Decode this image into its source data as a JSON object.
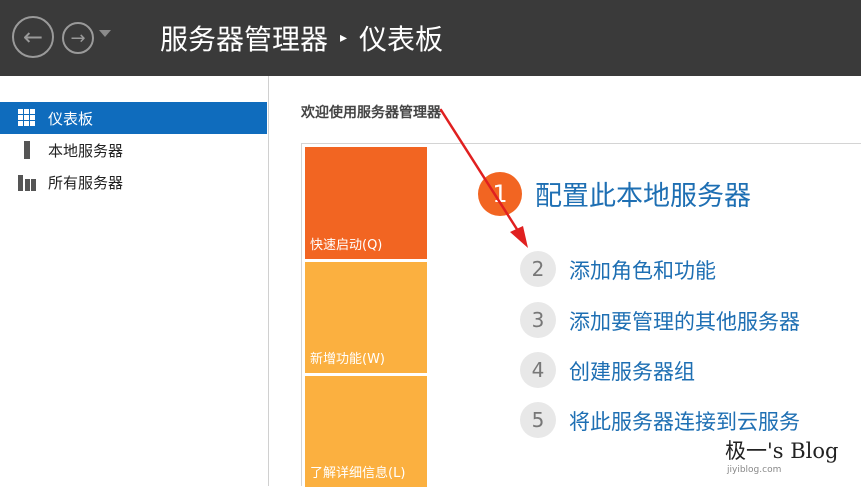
{
  "header": {
    "title_app": "服务器管理器",
    "separator": "▸",
    "title_page": "仪表板",
    "back_glyph": "←",
    "forward_glyph": "→"
  },
  "sidebar": {
    "items": [
      {
        "label": "仪表板",
        "icon": "dashboard-icon",
        "active": true
      },
      {
        "label": "本地服务器",
        "icon": "local-server-icon",
        "active": false
      },
      {
        "label": "所有服务器",
        "icon": "all-servers-icon",
        "active": false
      }
    ]
  },
  "main": {
    "welcome": "欢迎使用服务器管理器",
    "tiles": [
      {
        "label": "快速启动(Q)"
      },
      {
        "label": "新增功能(W)"
      },
      {
        "label": "了解详细信息(L)"
      }
    ],
    "steps": [
      {
        "num": "1",
        "label": "配置此本地服务器"
      },
      {
        "num": "2",
        "label": "添加角色和功能"
      },
      {
        "num": "3",
        "label": "添加要管理的其他服务器"
      },
      {
        "num": "4",
        "label": "创建服务器组"
      },
      {
        "num": "5",
        "label": "将此服务器连接到云服务"
      }
    ]
  },
  "watermark": {
    "main": "极一's Blog",
    "sub": "jiyiblog.com"
  },
  "colors": {
    "header_bg": "#3a3a3a",
    "accent_blue": "#0f6cbd",
    "link_blue": "#1e6fb3",
    "tile_orange": "#f26522",
    "tile_amber": "#fbb040",
    "annotation_red": "#e02020"
  }
}
